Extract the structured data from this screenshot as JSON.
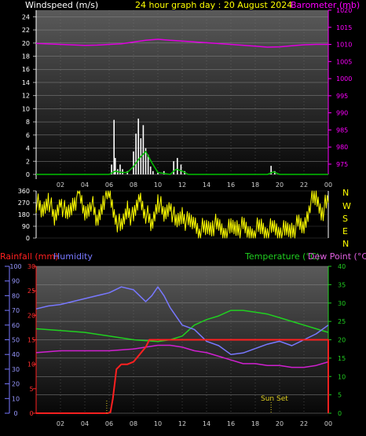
{
  "header": {
    "windspeed_label": "Windspeed (m/s)",
    "title": "24 hour graph day : 20 August 2024",
    "barometer_label": "Barometer (mb)"
  },
  "compass": [
    "N",
    "W",
    "S",
    "E",
    "N"
  ],
  "bottom_labels": {
    "rainfall": "Rainfall (mm)",
    "humidity": "Humidity",
    "temperature": "Temperature (°C)",
    "dewpoint": "Dew Point (°C)",
    "sunset": "Sun Set"
  },
  "colors": {
    "wind": "#ffffff",
    "wind_avg": "#00c000",
    "barometer": "#e000e0",
    "direction": "#ffff00",
    "rain": "#ff2020",
    "humidity": "#7878ff",
    "temperature": "#20d020",
    "dewpoint": "#d020d0"
  },
  "chart_data": [
    {
      "type": "line",
      "title": "24 hour graph day : 20 August 2024",
      "xticks": [
        "02",
        "04",
        "06",
        "08",
        "10",
        "12",
        "14",
        "16",
        "18",
        "20",
        "22",
        "00"
      ],
      "y_left": {
        "label": "Windspeed (m/s)",
        "range": [
          0,
          25
        ],
        "ticks": [
          0,
          2,
          4,
          6,
          8,
          10,
          12,
          14,
          16,
          18,
          20,
          22,
          24
        ]
      },
      "y_right": {
        "label": "Barometer (mb)",
        "range": [
          972,
          1020
        ],
        "ticks": [
          975,
          980,
          985,
          990,
          995,
          1000,
          1005,
          1010,
          1015,
          1020
        ]
      },
      "series": [
        {
          "name": "Barometer (mb)",
          "axis": "right",
          "x": [
            0,
            2,
            4,
            5,
            6,
            7,
            8,
            9,
            10,
            11,
            12,
            14,
            16,
            18,
            19,
            20,
            21,
            22,
            23,
            24
          ],
          "values": [
            1010.3,
            1010,
            1009.7,
            1009.8,
            1010,
            1010.2,
            1010.7,
            1011.2,
            1011.5,
            1011.2,
            1011,
            1010.5,
            1010,
            1009.5,
            1009.2,
            1009.3,
            1009.6,
            1009.9,
            1010,
            1010
          ]
        },
        {
          "name": "Windspeed (m/s)",
          "axis": "left",
          "x": [
            0,
            5.9,
            6.2,
            6.4,
            6.5,
            6.7,
            6.9,
            7.1,
            7.3,
            7.5,
            7.7,
            8.0,
            8.2,
            8.4,
            8.6,
            8.8,
            9.0,
            9.2,
            9.4,
            9.6,
            10.0,
            10.5,
            11.0,
            11.3,
            11.6,
            11.9,
            12.2,
            12.6,
            13.0,
            19.0,
            19.3,
            19.6,
            20.0,
            24
          ],
          "values": [
            0,
            0,
            1.5,
            8.3,
            2.5,
            0.8,
            1.5,
            0.8,
            0,
            0.5,
            0,
            3.5,
            6.2,
            8.5,
            5.5,
            7.5,
            4,
            3,
            1.2,
            0.5,
            0.3,
            0.5,
            0,
            2,
            2.5,
            1.5,
            0.5,
            0,
            0,
            0,
            1.3,
            0.5,
            0,
            0
          ]
        },
        {
          "name": "Average windspeed (m/s)",
          "axis": "left",
          "x": [
            0,
            6.0,
            6.5,
            7.0,
            7.5,
            8.0,
            8.5,
            9.0,
            9.5,
            10.0,
            11.0,
            11.5,
            12.0,
            12.5,
            19.0,
            19.5,
            20.0,
            24
          ],
          "values": [
            0,
            0,
            0.5,
            0.3,
            0.3,
            1.2,
            2.5,
            3.5,
            1.8,
            0.3,
            0,
            0.8,
            0.5,
            0,
            0,
            0.4,
            0,
            0
          ]
        }
      ]
    },
    {
      "type": "line",
      "xticks": [],
      "y_left": {
        "range": [
          0,
          360
        ],
        "ticks": [
          0,
          90,
          180,
          270,
          360
        ]
      },
      "y_right": {
        "labels": [
          "N",
          "W",
          "S",
          "E",
          "N"
        ]
      },
      "series": [
        {
          "name": "Wind direction",
          "axis": "left",
          "x": [
            0,
            0.5,
            1,
            1.5,
            2,
            2.5,
            3,
            3.5,
            4,
            4.5,
            5,
            5.5,
            6,
            6.5,
            7,
            7.5,
            8,
            8.5,
            9,
            9.5,
            10,
            10.5,
            11,
            11.5,
            12,
            12.5,
            13,
            13.5,
            14,
            14.5,
            15,
            15.5,
            16,
            16.5,
            17,
            17.5,
            18,
            18.5,
            19,
            19.5,
            20,
            20.5,
            21,
            21.5,
            22,
            22.5,
            23,
            23.5,
            24
          ],
          "values": [
            280,
            190,
            320,
            120,
            300,
            150,
            260,
            340,
            180,
            290,
            110,
            300,
            330,
            170,
            60,
            240,
            130,
            320,
            200,
            80,
            310,
            150,
            270,
            90,
            190,
            100,
            120,
            60,
            70,
            110,
            80,
            50,
            60,
            90,
            70,
            40,
            60,
            80,
            50,
            70,
            60,
            40,
            70,
            90,
            80,
            280,
            300,
            210,
            270
          ]
        }
      ]
    },
    {
      "type": "line",
      "xticks": [
        "02",
        "04",
        "06",
        "08",
        "10",
        "12",
        "14",
        "16",
        "18",
        "20",
        "22",
        "00"
      ],
      "y_rain": {
        "label": "Rainfall (mm)",
        "range": [
          0,
          30
        ],
        "ticks": [
          0,
          5,
          10,
          15,
          20,
          25,
          30
        ]
      },
      "y_humidity": {
        "label": "Humidity",
        "range": [
          0,
          100
        ],
        "ticks": [
          0,
          10,
          20,
          30,
          40,
          50,
          60,
          70,
          80,
          90,
          100
        ]
      },
      "y_temp": {
        "label": "Temperature (°C)",
        "range": [
          0,
          40
        ],
        "ticks": [
          0,
          5,
          10,
          15,
          20,
          25,
          30,
          35,
          40
        ]
      },
      "annotations": [
        {
          "label": "Sun Set",
          "x": 19.3
        }
      ],
      "series": [
        {
          "name": "Rainfall (mm)",
          "axis": "rain",
          "x": [
            0,
            5.9,
            6.1,
            6.3,
            6.6,
            7.0,
            7.5,
            8.0,
            8.5,
            9.0,
            9.3,
            9.6,
            24,
            24
          ],
          "values": [
            0,
            0,
            0.2,
            3,
            9,
            10,
            10,
            10.5,
            12,
            13.5,
            15,
            15,
            15,
            0
          ]
        },
        {
          "name": "Humidity",
          "axis": "humidity",
          "x": [
            0,
            1,
            2,
            3,
            4,
            5,
            6,
            7,
            8,
            9,
            9.5,
            10,
            10.5,
            11,
            12,
            13,
            14,
            15,
            16,
            17,
            18,
            19,
            20,
            21,
            22,
            23,
            24
          ],
          "values": [
            71,
            73,
            74,
            76,
            78,
            80,
            82,
            86,
            84,
            76,
            80,
            86,
            80,
            72,
            60,
            57,
            49,
            46,
            40,
            41,
            44,
            47,
            49,
            46,
            50,
            54,
            60
          ]
        },
        {
          "name": "Temperature (°C)",
          "axis": "temp",
          "x": [
            0,
            2,
            4,
            6,
            8,
            10,
            11,
            12,
            13,
            14,
            15,
            16,
            17,
            18,
            19,
            20,
            21,
            22,
            23,
            24
          ],
          "values": [
            23,
            22.5,
            22,
            21,
            20,
            19.5,
            20,
            21,
            24,
            25.5,
            26.5,
            28,
            28,
            27.5,
            27,
            26,
            25,
            24,
            23,
            22
          ]
        },
        {
          "name": "Dew Point (°C)",
          "axis": "temp",
          "x": [
            0,
            2,
            4,
            6,
            8,
            9,
            10,
            11,
            12,
            13,
            14,
            15,
            16,
            17,
            18,
            19,
            20,
            21,
            22,
            23,
            24
          ],
          "values": [
            16.5,
            17,
            17,
            17,
            17.5,
            18,
            18.5,
            18.5,
            18,
            17,
            16.5,
            15.5,
            14.5,
            13.5,
            13.5,
            13,
            13,
            12.5,
            12.5,
            13,
            14
          ]
        }
      ]
    }
  ]
}
